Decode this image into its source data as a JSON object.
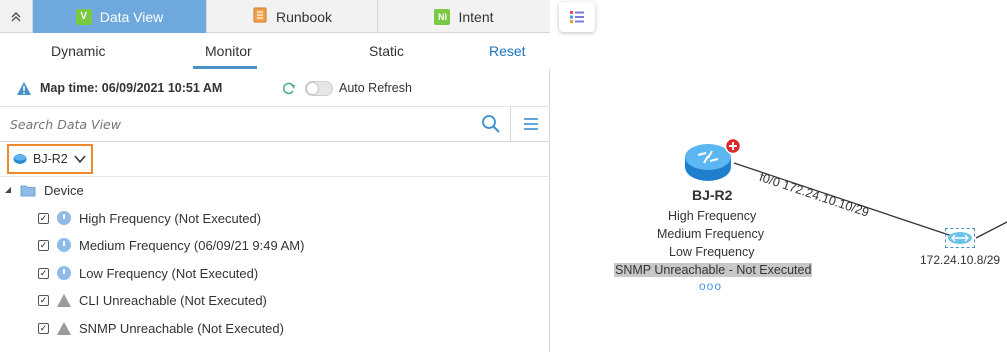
{
  "tabs": [
    {
      "label": "Data View",
      "icon": "V",
      "icon_color": "#7ac943"
    },
    {
      "label": "Runbook",
      "icon": "runbook",
      "icon_color": "#f4a24a"
    },
    {
      "label": "Intent",
      "icon": "NI",
      "icon_color": "#7ac943"
    }
  ],
  "subtabs": {
    "dynamic": "Dynamic",
    "monitor": "Monitor",
    "static": "Static",
    "reset": "Reset"
  },
  "map_time": {
    "label": "Map time: 06/09/2021 10:51 AM",
    "auto_refresh": "Auto Refresh"
  },
  "search": {
    "placeholder": "Search Data View"
  },
  "device_selector": {
    "label": "BJ-R2"
  },
  "tree": {
    "root": "Device",
    "items": [
      {
        "label": "High Frequency (Not Executed)",
        "icon": "clock"
      },
      {
        "label": "Medium Frequency (06/09/21 9:49 AM)",
        "icon": "clock"
      },
      {
        "label": "Low Frequency (Not Executed)",
        "icon": "clock"
      },
      {
        "label": "CLI Unreachable (Not Executed)",
        "icon": "warning"
      },
      {
        "label": "SNMP Unreachable (Not Executed)",
        "icon": "warning"
      }
    ]
  },
  "map": {
    "node": {
      "name": "BJ-R2",
      "lines": [
        "High Frequency",
        "Medium Frequency",
        "Low Frequency"
      ],
      "highlight": "SNMP Unreachable - Not Executed",
      "more": "ooo"
    },
    "link_label": "f0/0 172.24.10.10/29",
    "subnet_label": "172.24.10.8/29"
  },
  "colors": {
    "accent": "#6fa8dc",
    "highlight_border": "#ef8a2c",
    "link": "#1a73c4"
  }
}
